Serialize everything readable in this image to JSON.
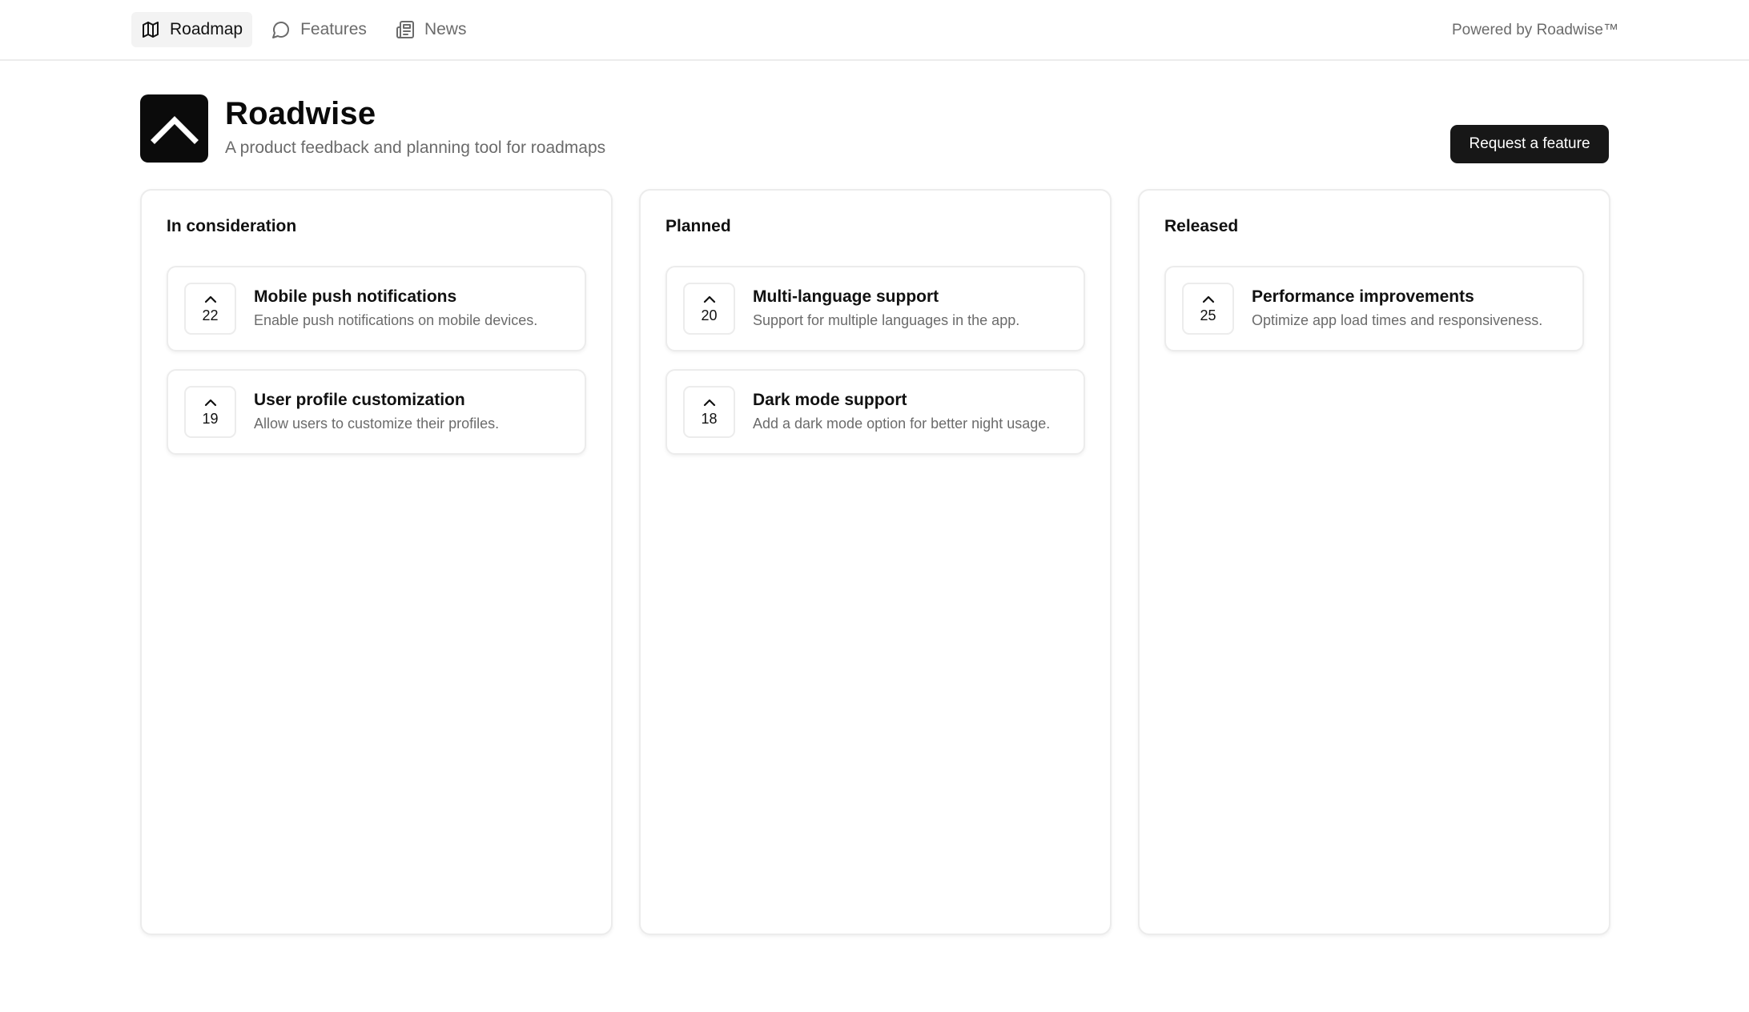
{
  "nav": {
    "items": [
      {
        "label": "Roadmap",
        "icon": "map-icon",
        "active": true
      },
      {
        "label": "Features",
        "icon": "message-circle-icon",
        "active": false
      },
      {
        "label": "News",
        "icon": "newspaper-icon",
        "active": false
      }
    ],
    "powered_by": "Powered by Roadwise™"
  },
  "header": {
    "logo_icon": "chevron-up-icon",
    "title": "Roadwise",
    "subtitle": "A product feedback and planning tool for roadmaps",
    "request_button": "Request a feature"
  },
  "columns": [
    {
      "title": "In consideration",
      "cards": [
        {
          "votes": "22",
          "title": "Mobile push notifications",
          "description": "Enable push notifications on mobile devices."
        },
        {
          "votes": "19",
          "title": "User profile customization",
          "description": "Allow users to customize their profiles."
        }
      ]
    },
    {
      "title": "Planned",
      "cards": [
        {
          "votes": "20",
          "title": "Multi-language support",
          "description": "Support for multiple languages in the app."
        },
        {
          "votes": "18",
          "title": "Dark mode support",
          "description": "Add a dark mode option for better night usage."
        }
      ]
    },
    {
      "title": "Released",
      "cards": [
        {
          "votes": "25",
          "title": "Performance improvements",
          "description": "Optimize app load times and responsiveness."
        }
      ]
    }
  ],
  "colors": {
    "primary_button_bg": "#171717",
    "muted_text": "#6b6b6b",
    "border": "#ececec",
    "logo_bg": "#0b0b0b"
  }
}
